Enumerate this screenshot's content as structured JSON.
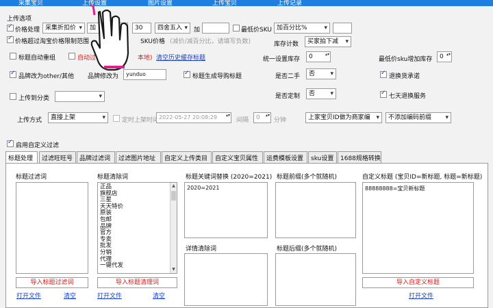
{
  "nav": [
    "采集宝贝",
    "上传设置",
    "图片设置",
    "上传宝贝",
    "上传记录"
  ],
  "section_title": "上传选项",
  "row1": {
    "price_label": "价格处理",
    "price_mode": "采集折扣价",
    "price_op": "加",
    "value": "30",
    "rounding": "四舍五入",
    "add_label": "加",
    "add_value": "",
    "min_sku_label": "最低价SKU",
    "min_sku_mode": "加百分比%",
    "min_sku_value": ""
  },
  "row2": {
    "limit_label": "价格超过淘宝价格限制范围",
    "sku_price_label": "SKU价格",
    "hint": "(减价/减百分比，请填写负数)",
    "stock_count_label": "库存计数",
    "stock_count": "买家拍下减"
  },
  "row3": {
    "auto_title": "标题自动重组",
    "auto_local": "自动过",
    "local_suffix": "本地)",
    "clear_cache": "清空历史缓存标题",
    "stock_label": "统一设置库存",
    "stock_value": "0",
    "min_sku_stock_label": "最低价sku增加库存",
    "min_sku_stock": "0"
  },
  "row4": {
    "brand_other": "品牌改为other/其他",
    "brand_change_label": "品牌修改为",
    "brand_value": "yunduo",
    "gen_title": "标题生成导购标题",
    "second_hand_label": "是否二手",
    "second_hand": "否",
    "return_promise": "退换货承诺"
  },
  "row5": {
    "upload_category": "上传到分类",
    "category_value": "",
    "custom_made_label": "是否定制",
    "custom_made": "否",
    "seven_day": "七天退换服务"
  },
  "row6": {
    "upload_mode_label": "上传方式",
    "upload_mode": "直接上架",
    "timed_label": "定时上架时间",
    "timed_value": "2022-05-27 20:08:29",
    "interval_label": "间隔",
    "interval_value": "0",
    "minute_label": "分钟",
    "merchant_code": "上家宝贝ID做为商家编",
    "no_prefix": "不添加编码前缀"
  },
  "enable_filter": "启用自定义过滤",
  "tabs": [
    "标题处理",
    "过滤旺旺号",
    "品牌过滤词",
    "过滤图片地址",
    "自定义上传类目",
    "自定义宝贝属性",
    "运费模板设置",
    "sku设置",
    "1688规格转换"
  ],
  "panel": {
    "title_filter_label": "标题过滤词",
    "title_clear_label": "标题清除词",
    "title_clear_items": [
      "正品",
      "旗舰店",
      "三星",
      "天天特价",
      "原装",
      "包邮",
      "品牌",
      "官方",
      "专卖",
      "批发",
      "分销",
      "代理",
      "一键代发"
    ],
    "keyword_replace_label": "标题关键词替换 (2020=2021)",
    "keyword_replace_value": "2020=2021",
    "prefix_label": "标题前缀(多个就随机)",
    "custom_title_label": "自定义标题 (宝贝ID=新标题, 标题=新标题)",
    "custom_title_value": "88888888=宝贝新标题",
    "detail_clear_label": "详情清除词",
    "suffix_label": "标题后缀(多个就随机)",
    "import_filter": "导入标题过滤词",
    "import_clear": "导入标题清理词",
    "import_custom": "导入自定义标题",
    "open_file": "打开文件",
    "clear": "清空"
  }
}
